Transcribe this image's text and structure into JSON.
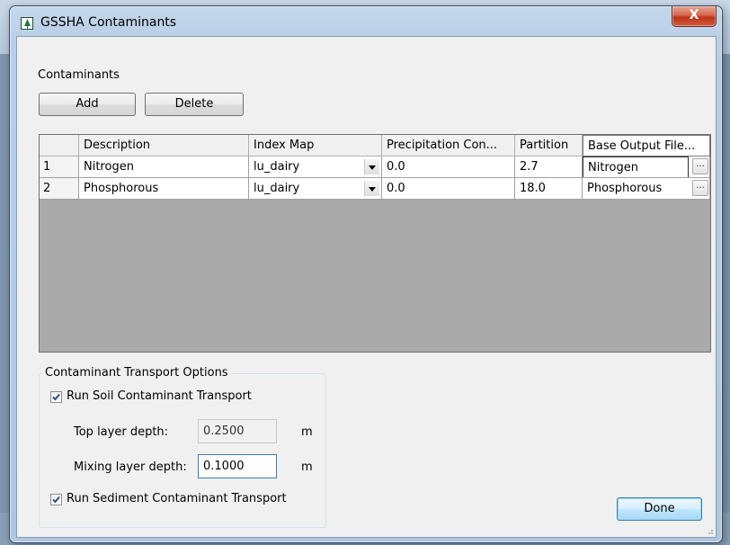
{
  "window": {
    "title": "GSSHA Contaminants",
    "close_glyph": "X",
    "icon": "tree-icon"
  },
  "contaminants": {
    "label": "Contaminants",
    "add_label": "Add",
    "delete_label": "Delete"
  },
  "grid": {
    "columns": [
      "Description",
      "Index Map",
      "Precipitation Con...",
      "Partition",
      "Base Output File..."
    ],
    "rows": [
      {
        "num": "1",
        "description": "Nitrogen",
        "index_map": "lu_dairy",
        "precip": "0.0",
        "partition": "2.7",
        "base_output": "Nitrogen"
      },
      {
        "num": "2",
        "description": "Phosphorous",
        "index_map": "lu_dairy",
        "precip": "0.0",
        "partition": "18.0",
        "base_output": "Phosphorous"
      }
    ],
    "ellipsis": "..."
  },
  "transport": {
    "group_label": "Contaminant Transport Options",
    "soil_label": "Run Soil Contaminant Transport",
    "soil_checked": true,
    "top_depth_label": "Top layer depth:",
    "top_depth_value": "0.2500",
    "top_depth_unit": "m",
    "mixing_depth_label": "Mixing layer depth:",
    "mixing_depth_value": "0.1000",
    "mixing_depth_unit": "m",
    "sediment_label": "Run Sediment Contaminant Transport",
    "sediment_checked": true
  },
  "footer": {
    "done_label": "Done"
  }
}
